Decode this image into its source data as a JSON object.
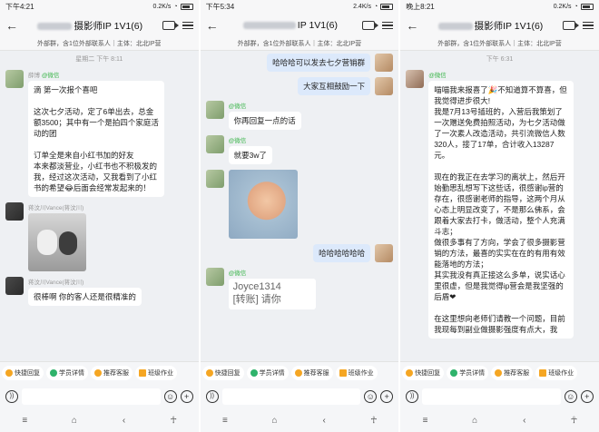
{
  "panels": [
    {
      "status_time": "下午4:21",
      "status_speed": "0.2K/s",
      "title": "摄影师IP 1V1(6)",
      "subtitle": "外部群，含1位外部联系人｜主体：北北IP营",
      "timestamp": "星期二 下午 8:11",
      "messages": [
        {
          "side": "left",
          "sender": "薛博",
          "tag": "@微信",
          "kind": "text",
          "text": "滴 第一次报个喜吧\n\n这次七夕活动，定了6单出去，总金额3500；其中有一个是拍四个家庭活动的团\n\n订单全是来自小红书加的好友\n本来都淡营业，小红书也不积极发的我，经过这次活动，又我看到了小红书的希望😂后面会经常发起来的！"
        },
        {
          "side": "left",
          "sender": "蒋汶川Vance(蒋汶川)",
          "tag": "",
          "kind": "image-cats",
          "text": ""
        },
        {
          "side": "left",
          "sender": "蒋汶川Vance(蒋汶川)",
          "tag": "",
          "kind": "text",
          "text": "很棒啊 你的客人还是很精准的"
        }
      ],
      "chips": [
        "快捷回复",
        "学员详情",
        "推荐客服",
        "班级作业"
      ]
    },
    {
      "status_time": "下午5:34",
      "status_speed": "2.4K/s",
      "title": "IP 1V1(6)",
      "subtitle": "外部群，含1位外部联系人｜主体：北北IP营",
      "timestamp": "",
      "messages": [
        {
          "side": "right",
          "sender": "",
          "tag": "",
          "kind": "text",
          "text": "哈哈哈可以发去七夕营销群"
        },
        {
          "side": "right",
          "sender": "",
          "tag": "",
          "kind": "text",
          "text": "大家互相鼓励一下"
        },
        {
          "side": "left",
          "sender": "",
          "tag": "@微信",
          "kind": "text",
          "text": "你再回复一点的话"
        },
        {
          "side": "left",
          "sender": "",
          "tag": "@微信",
          "kind": "text",
          "text": "就要3w了"
        },
        {
          "side": "left",
          "sender": "",
          "tag": "",
          "kind": "image-kid",
          "text": ""
        },
        {
          "side": "right",
          "sender": "",
          "tag": "",
          "kind": "text",
          "text": "哈哈哈哈哈哈"
        },
        {
          "side": "left",
          "sender": "",
          "tag": "@微信",
          "kind": "transfer",
          "text": "Joyce1314\n[转账] 请你"
        }
      ],
      "chips": [
        "快捷回复",
        "学员详情",
        "推荐客服",
        "班级作业"
      ]
    },
    {
      "status_time": "晚上8:21",
      "status_speed": "0.2K/s",
      "title": "摄影师IP 1V1(6)",
      "subtitle": "外部群，含1位外部联系人｜主体：北北IP营",
      "timestamp": "下午 6:31",
      "messages": [
        {
          "side": "left",
          "sender": "",
          "tag": "@微信",
          "kind": "text",
          "text": "喵喵我来报喜了🎉不知道算不算喜，但我觉得进步很大!\n我是7月13号插班的，入营后我策划了一次赠送免费拍照活动，为七夕活动做了一次素人改造活动，共引流微信人数320人，接了17单，合计收入13287元。\n\n现在的我正在去学习的离状上，然后开始勤思乱想写下这些话，很感谢ip营的存在，很感谢老师的指导，这两个月从心态上明显改变了，不是那么佛系，会跟着大家去打卡，做活动，整个人充满斗志；\n做很多事有了方向，学会了很多摄影营销的方法，最喜的实实在在的有用有效能落地的方法；\n其实我没有真正接这么多单，说实话心里很虚，但是我觉得ip营会是我坚强的后盾❤\n\n在这里想向老师们请教一个问题，目前我现每到副业做摄影强度有点大，我"
        }
      ],
      "chips": [
        "快捷回复",
        "学员详情",
        "推荐客服",
        "班级作业"
      ]
    }
  ],
  "chip_colors": [
    "#f5a623",
    "#2fb36b",
    "#f5a623",
    "#f5a623"
  ],
  "input": {
    "placeholder": ""
  },
  "icons": {
    "back": "back-arrow-icon",
    "video": "video-call-icon",
    "menu": "menu-icon",
    "voice": "voice-icon",
    "emoji": "emoji-icon",
    "plus": "plus-icon"
  },
  "nav": {
    "menu": "≡",
    "home": "⌂",
    "back": "‹",
    "access": "☥"
  }
}
